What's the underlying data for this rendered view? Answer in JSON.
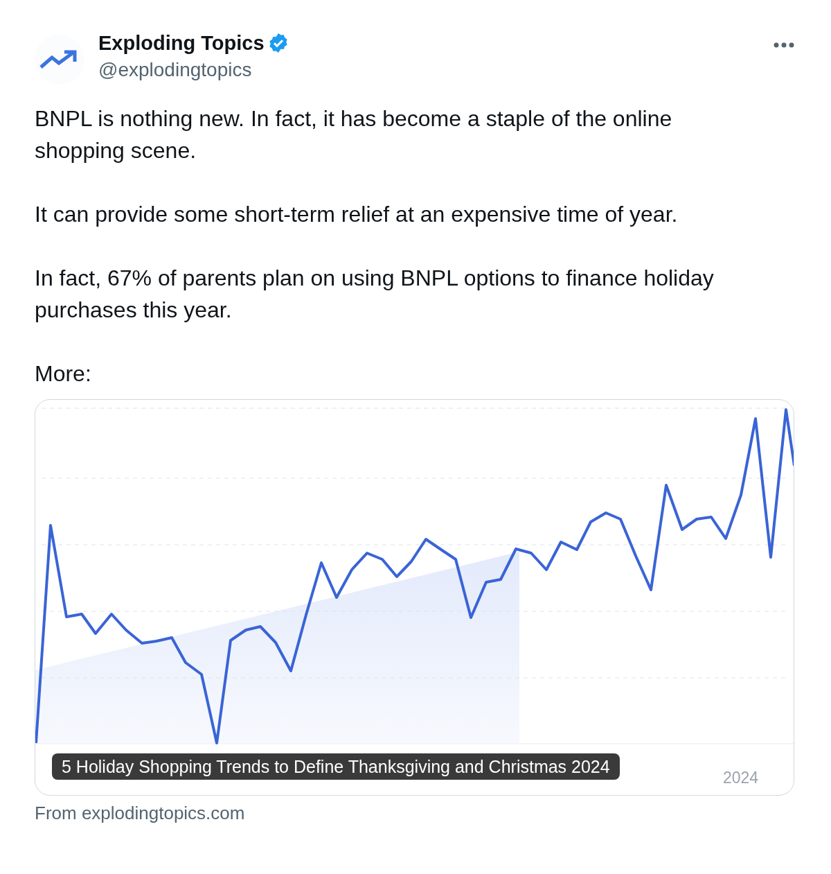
{
  "author": {
    "name": "Exploding Topics",
    "verified": true,
    "handle": "@explodingtopics"
  },
  "paragraphs": [
    "BNPL is nothing new. In fact, it has become a staple of the online shopping scene.",
    "It can provide some short-term relief at an expensive time of year.",
    "In fact, 67% of parents plan on using BNPL options to finance holiday purchases this year.",
    "More:"
  ],
  "card": {
    "axis_label": "2024",
    "caption": "5 Holiday Shopping Trends to Define Thanksgiving and Christmas 2024"
  },
  "source": "From explodingtopics.com"
}
